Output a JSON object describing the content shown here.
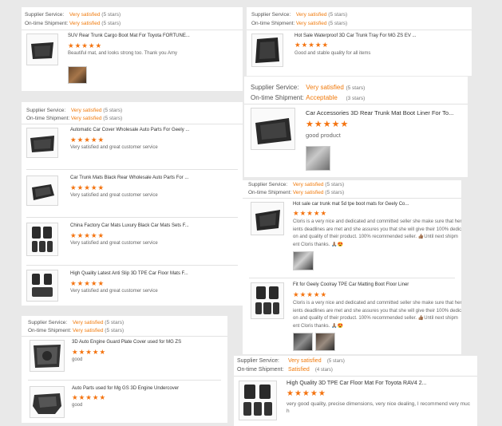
{
  "labels": {
    "supplier_service": "Supplier Service:",
    "ontime_shipment": "On-time Shipment:"
  },
  "colors": {
    "accent": "#f07a0c",
    "star": "#f4730f"
  },
  "left": [
    {
      "supplier_value": "Very satisfied",
      "supplier_stars": "(5 stars)",
      "shipment_value": "Very satisfied",
      "shipment_stars": "(5 stars)",
      "products": [
        {
          "title": "SUV Rear Trunk Cargo Boot Mat For Toyota FORTUNE...",
          "stars": "★★★★★",
          "review": "Beautiful mat, and looks strong too. Thank you Amy",
          "icon": "trunk-mat-icon",
          "photos": 1
        }
      ]
    },
    {
      "supplier_value": "Very satisfied",
      "supplier_stars": "(5 stars)",
      "shipment_value": "Very satisfied",
      "shipment_stars": "(5 stars)",
      "products": [
        {
          "title": "Automatic Car Cover Wholesale Auto Parts For Geely ...",
          "stars": "★★★★★",
          "review": "Very satisfied and great customer service",
          "icon": "trunk-mat-icon"
        },
        {
          "title": "Car Trunk Mats Black Rear Wholesale Auto Parts For ...",
          "stars": "★★★★★",
          "review": "Very satisfied and great customer service",
          "icon": "trunk-mat-icon"
        },
        {
          "title": "China Factory Car Mats Luxury Black Car Mats Sets F...",
          "stars": "★★★★★",
          "review": "Very satisfied and great customer service",
          "icon": "floor-mat-set-icon"
        },
        {
          "title": "High Quality Latest Anti Slip 3D TPE Car Floor Mats F...",
          "stars": "★★★★★",
          "review": "Very satisfied and great customer service",
          "icon": "floor-mat-set-icon"
        }
      ]
    },
    {
      "supplier_value": "Very satisfied",
      "supplier_stars": "(5 stars)",
      "shipment_value": "Very satisfied",
      "shipment_stars": "(5 stars)",
      "products": [
        {
          "title": "3D Auto Engine Guard Plate Cover used for MG ZS",
          "stars": "★★★★★",
          "review": "good",
          "icon": "engine-guard-icon"
        },
        {
          "title": "Auto Parts used for Mg GS 3D Engine Undercover",
          "stars": "★★★★★",
          "review": "good",
          "icon": "engine-guard-icon"
        }
      ]
    }
  ],
  "right": [
    {
      "supplier_value": "Very satisfied",
      "supplier_stars": "(5 stars)",
      "shipment_value": "Very satisfied",
      "shipment_stars": "(5 stars)",
      "products": [
        {
          "title": "Hot Sale Waterproof 3D Car Trunk Tray For MG ZS EV ...",
          "stars": "★★★★★",
          "review": "Good and stable quality for all items",
          "icon": "trunk-tray-icon"
        }
      ]
    },
    {
      "supplier_value": "Very satisfied",
      "supplier_stars": "(5 stars)",
      "shipment_value": "Acceptable",
      "shipment_stars": "(3 stars)",
      "products": [
        {
          "title": "Car Accessories 3D Rear Trunk Mat Boot Liner For To...",
          "stars": "★★★★★",
          "review": "good product",
          "icon": "trunk-mat-icon",
          "photos": 1
        }
      ]
    },
    {
      "supplier_value": "Very satisfied",
      "supplier_stars": "(5 stars)",
      "shipment_value": "Very satisfied",
      "shipment_stars": "(5 stars)",
      "products": [
        {
          "title": "Hot sale car trunk mat 5d tpe boot mats for Geely Co...",
          "stars": "★★★★★",
          "review_lines": [
            "Cloris is a very nice and dedicated and committed seller she make sure that her cl",
            "ients deadlines are met and she assures you that she will give their 100% dedicati",
            "on and quality of their product. 100% recommended seller. 👍🏽Until next shipm",
            "ent Cloris thanks. 🙏🏽😍"
          ],
          "icon": "trunk-mat-icon",
          "photos": 1
        },
        {
          "title": "Fit for Geely Coolray TPE Car Matting Boot Floor Liner",
          "stars": "★★★★★",
          "review_lines": [
            "Cloris is a very nice and dedicated and committed seller she make sure that her cl",
            "ients deadlines are met and she assures you that she will give their 100% dedicati",
            "on and quality of their product. 100% recommended seller. 👍🏽Until next shipm",
            "ent Cloris thanks. 🙏🏽😍"
          ],
          "icon": "floor-mat-set-icon",
          "photos": 2
        }
      ]
    },
    {
      "supplier_value": "Very satisfied",
      "supplier_stars": "(5 stars)",
      "shipment_value": "Satisfied",
      "shipment_stars": "(4 stars)",
      "products": [
        {
          "title": "High Quality 3D TPE Car Floor Mat For Toyota RAV4 2...",
          "stars": "★★★★★",
          "review_lines": [
            "very good quality,  precise dimensions,  very nice dealing,  I recommend very muc",
            "h"
          ],
          "icon": "floor-mat-set-icon"
        }
      ]
    }
  ]
}
